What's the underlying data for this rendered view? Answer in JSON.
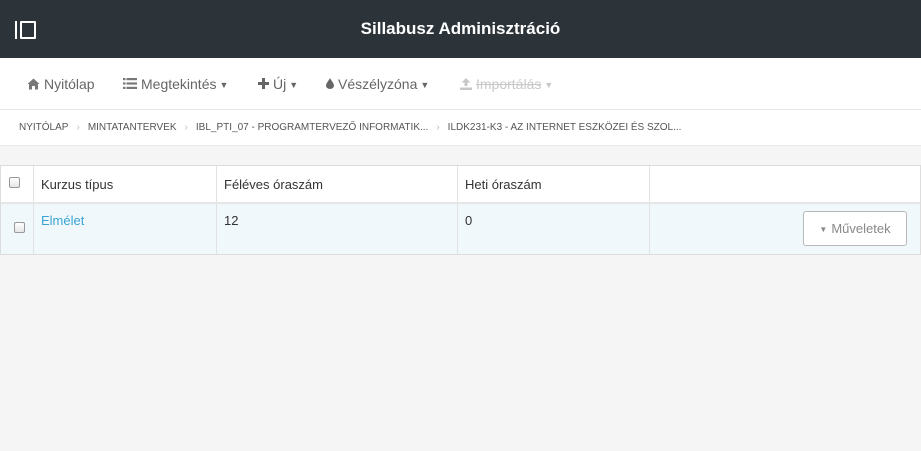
{
  "header": {
    "title": "Sillabusz Adminisztráció"
  },
  "toolbar": {
    "home_label": "Nyitólap",
    "view_label": "Megtekintés",
    "new_label": "Új",
    "danger_label": "Vészélyzóna",
    "import_label": "Importálás",
    "caret": "▼"
  },
  "breadcrumb": {
    "items": [
      "NYITÓLAP",
      "MINTATANTERVEK",
      "IBL_PTI_07 - PROGRAMTERVEZŐ INFORMATIK...",
      "ILDK231-K3 - AZ INTERNET ESZKÖZEI ÉS SZOL..."
    ],
    "separator": "›"
  },
  "table": {
    "columns": [
      "Kurzus típus",
      "Féléves óraszám",
      "Heti óraszám"
    ],
    "rows": [
      {
        "type": "Elmélet",
        "semester_hours": "12",
        "weekly_hours": "0"
      }
    ],
    "actions_label": "Műveletek"
  },
  "colors": {
    "topbar": "#2c3339",
    "link": "#3aa3d4",
    "row_highlight": "#f1f8fc"
  }
}
